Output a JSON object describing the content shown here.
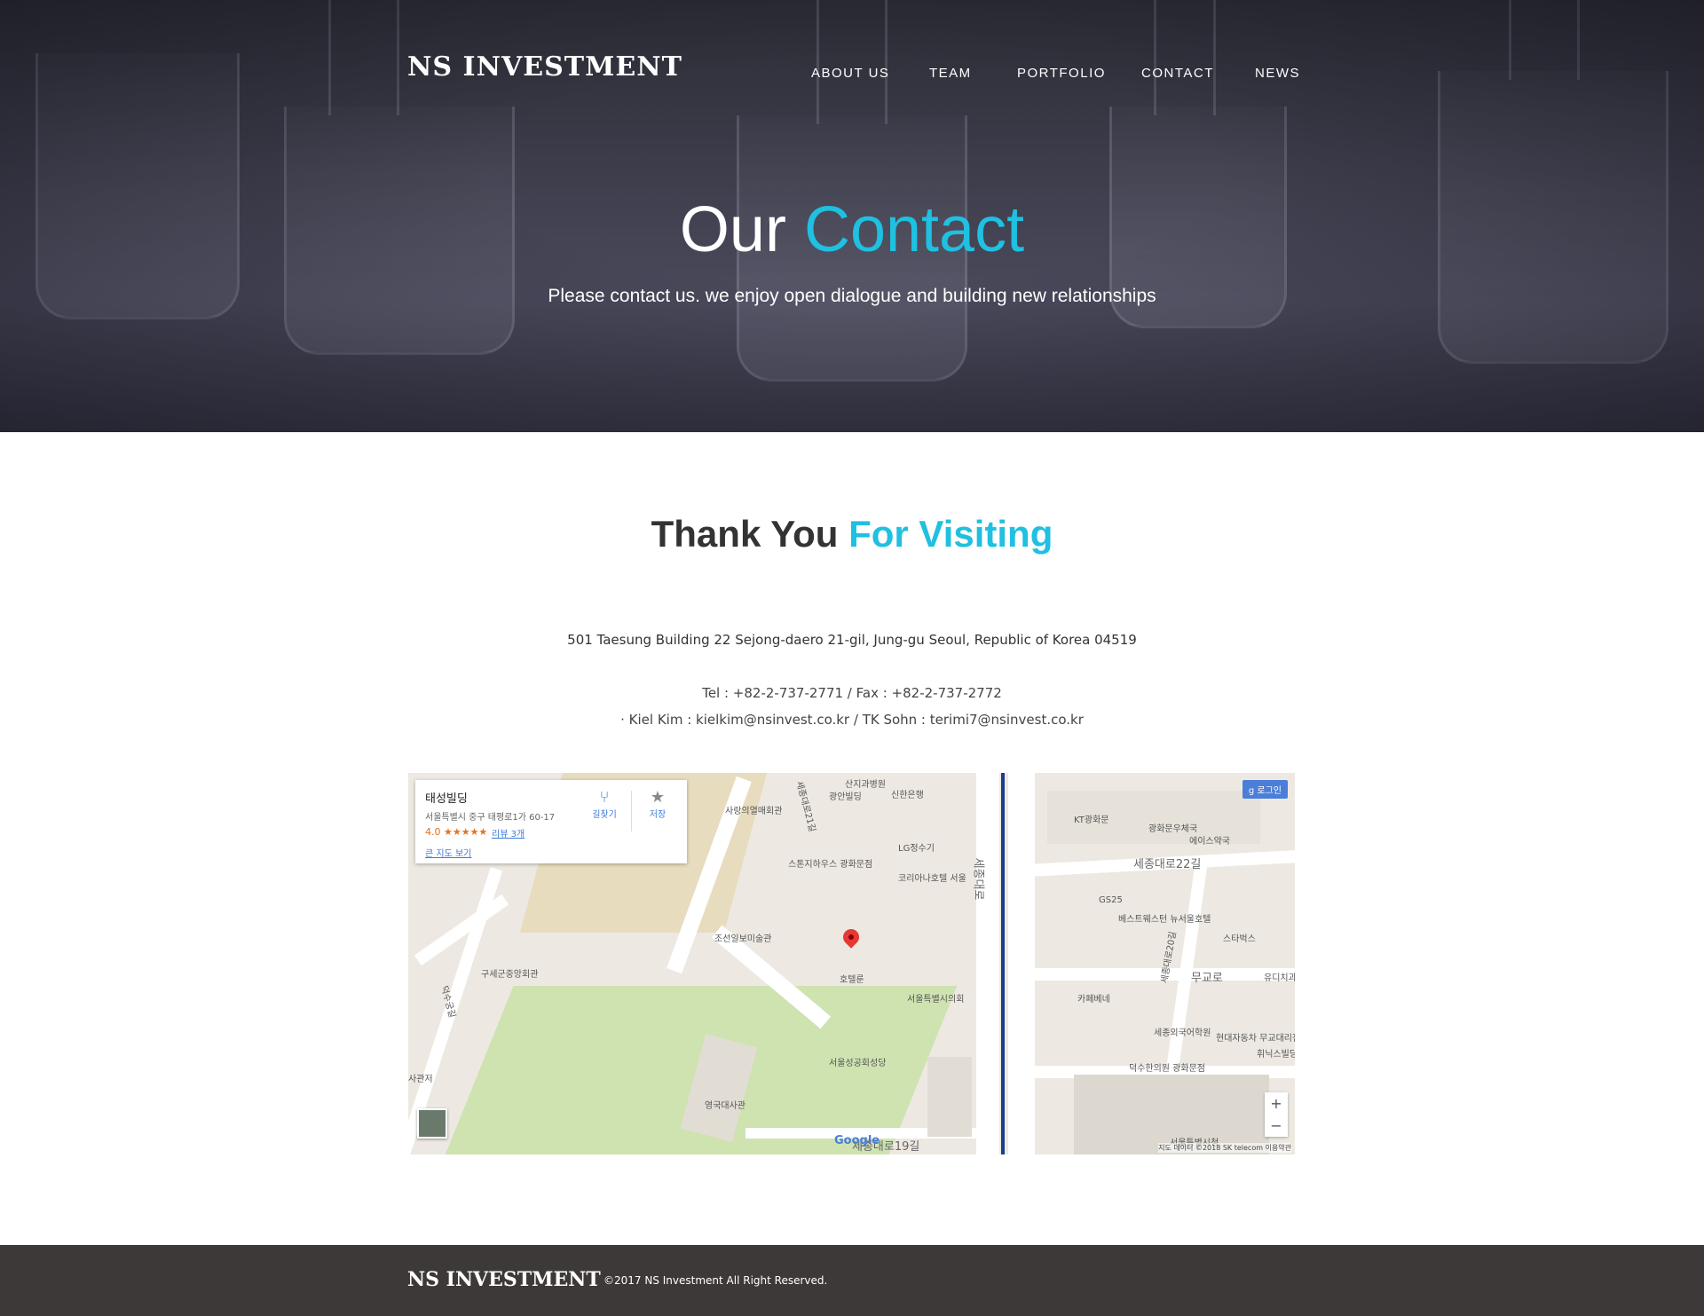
{
  "header": {
    "logo": "NS INVESTMENT",
    "nav": [
      {
        "label": "ABOUT US"
      },
      {
        "label": "TEAM"
      },
      {
        "label": "PORTFOLIO"
      },
      {
        "label": "CONTACT"
      },
      {
        "label": "NEWS"
      }
    ]
  },
  "hero": {
    "title_plain": "Our",
    "title_accent": "Contact",
    "subtitle": "Please contact us. we enjoy open dialogue and building new relationships",
    "accent_color": "#1fc0e0"
  },
  "contact": {
    "title_plain": "Thank You",
    "title_accent": "For Visiting",
    "address": "501 Taesung Building 22 Sejong-daero 21-gil, Jung-gu Seoul, Republic of Korea 04519",
    "tel_fax": "Tel : +82-2-737-2771 / Fax : +82-2-737-2772",
    "emails": "· Kiel Kim : kielkim@nsinvest.co.kr / TK Sohn : terimi7@nsinvest.co.kr"
  },
  "map": {
    "place_name": "태성빌딩",
    "place_address": "서울특별시 중구 태평로1가 60-17",
    "rating": "4.0 ★★★★★",
    "reviews": "리뷰 3개",
    "bigger_map": "큰 지도 보기",
    "directions": "길찾기",
    "save": "저장",
    "login": "로그인",
    "zoom_in": "+",
    "zoom_out": "−",
    "google": "Google",
    "attribution": "지도 데이터 ©2018 SK telecom   이용약관",
    "labels": [
      "산지과병원",
      "광안빌딩",
      "신한은행",
      "사랑의열매회관",
      "세종대로21길",
      "LG정수기",
      "스톤지하우스 광화문점",
      "코리아나호텔 서울",
      "조선일보미술관",
      "호텔룬",
      "서울특별시의회",
      "구세군중앙회관",
      "덕수궁길",
      "서울성공회성당",
      "영국대사관",
      "사관저",
      "세종대로19길",
      "세종대로",
      "KT광화문",
      "광화문우체국",
      "에이스약국",
      "세종대로22길",
      "GS25",
      "베스트웨스턴 뉴서울호텔",
      "스타벅스",
      "세종대로20길",
      "카페베네",
      "무교로",
      "유디치과",
      "세종외국어학원",
      "현대자동차 무교대리점",
      "덕수한의원 광화문점",
      "휘닉스빌딩",
      "서울특별시청"
    ]
  },
  "footer": {
    "logo": "NS INVESTMENT",
    "copyright": "©2017 NS Investment All Right Reserved."
  }
}
